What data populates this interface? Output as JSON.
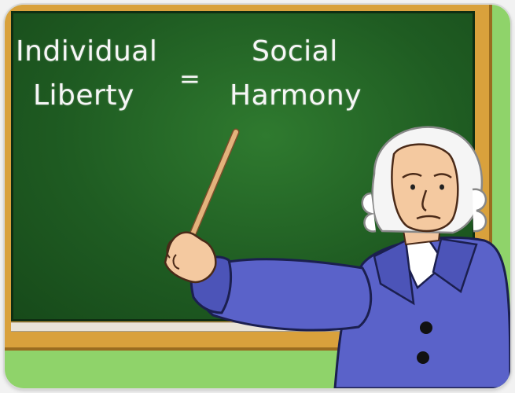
{
  "equation": {
    "left_line1": "Individual",
    "left_line2": "Liberty",
    "operator": "=",
    "right_line1": "Social",
    "right_line2": "Harmony"
  },
  "colors": {
    "board": "#1f5c22",
    "frame": "#d9a13c",
    "wall": "#8fd36a",
    "coat": "#5a62c9",
    "chalk": "#f6f6f6"
  }
}
